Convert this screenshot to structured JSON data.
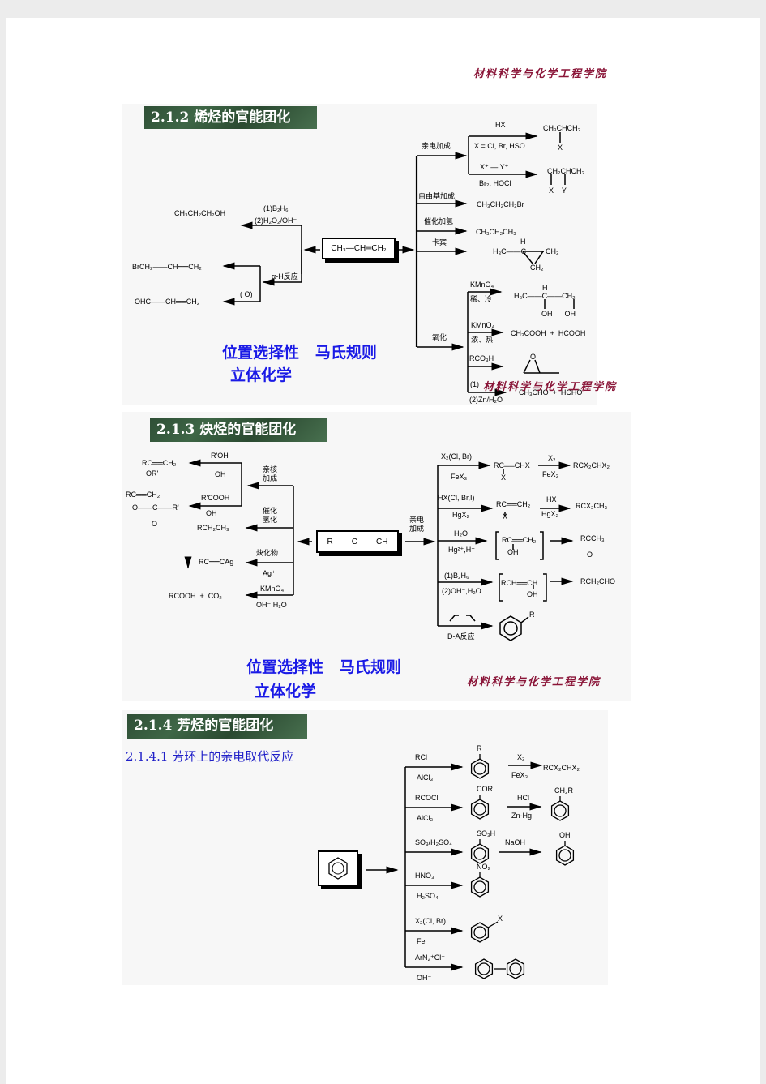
{
  "header": {
    "watermark": "材料科学与化学工程学院"
  },
  "section_212": {
    "title": "2.1.2 烯烃的官能团化",
    "center": "CH₃—CH═CH₂",
    "left": {
      "hydroboration": {
        "reagent_top": "(1)B₂H₆",
        "reagent_bottom": "(2)H₂O₂/OH⁻",
        "product": "CH₃CH₂CH₂OH"
      },
      "alpha_h_label": "α-H反应",
      "allyl_bromide": "BrCH₂——CH══CH₂",
      "oxidation_label": "( O)",
      "acrolein": "OHC——CH══CH₂"
    },
    "right": {
      "electrophilic": {
        "label": "亲电加成",
        "hx_reagent": "HX",
        "hx_note": "X = Cl, Br, HSO",
        "hx_product_top": "CH₃CHCH₃",
        "hx_product_sub": "X",
        "xy_reagent": "X⁺ — Y⁺",
        "xy_note": "Br₂, HOCl",
        "xy_product_top": "CH₂CHCH₃",
        "xy_product_sub": "X    Y"
      },
      "radical": {
        "label": "自由基加成",
        "product": "CH₃CH₂CH₂Br"
      },
      "hydrogenation": {
        "label": "催化加氢",
        "product": "CH₃CH₂CH₃"
      },
      "carbene": {
        "label": "卡宾",
        "product_h": "H",
        "product_left": "H₃C——C",
        "product_right": "CH₂",
        "product_bottom": "CH₂"
      },
      "oxidation": {
        "label": "氧化",
        "kmno4_cold": {
          "reagent": "KMnO₄",
          "cond": "稀、冷",
          "product_h": "H",
          "product": "H₃C——C——CH₂",
          "product_oh": "OH      OH"
        },
        "kmno4_hot": {
          "reagent": "KMnO₄",
          "cond": "浓、热",
          "product": "CH₃COOH  +  HCOOH"
        },
        "peracid": {
          "reagent": "RCO₃H",
          "product_o": "O"
        },
        "ozonolysis": {
          "reagent_top": "(1)",
          "reagent_bottom": "(2)Zn/H₂O",
          "product": "CH₃CHO  +  HCHO"
        }
      }
    },
    "notes": {
      "line1": "位置选择性   马氏规则",
      "line2": "立体化学"
    },
    "watermark": "材料科学与化学工程学院"
  },
  "section_213": {
    "title": "2.1.3 炔烃的官能团化",
    "center_r": "R",
    "center_c": "C",
    "center_ch": "CH",
    "left": {
      "nucleophilic_label": "亲核\n加成",
      "ether": {
        "reagent_top": "R'OH",
        "reagent_bottom": "OH⁻",
        "product_top": "RC══CH₂",
        "product_sub": "OR'"
      },
      "ester": {
        "reagent_top": "R'COOH",
        "reagent_bottom": "OH⁻",
        "product_top": "RC══CH₂",
        "product_mid": "O——C——R'",
        "product_bottom": "O"
      },
      "hydrogenation": {
        "label": "催化\n氢化",
        "product": "RCH₂CH₃"
      },
      "acetylide": {
        "label": "炔化物",
        "reagent": "Ag⁺",
        "product": "RC══CAg",
        "precipitate": "↓"
      },
      "oxidation": {
        "reagent_top": "KMnO₄",
        "reagent_bottom": "OH⁻,H₂O",
        "product": "RCOOH  +  CO₂"
      }
    },
    "right": {
      "label": "亲电\n加成",
      "halogen": {
        "reagent_top": "X₂(Cl, Br)",
        "reagent_bottom": "FeX₃",
        "intermediate": "RC══CHX",
        "intermediate_sub": "X",
        "step2_top": "X₂",
        "step2_bottom": "FeX₃",
        "product": "RCX₂CHX₂"
      },
      "hx": {
        "reagent_top": "HX(Cl, Br,I)",
        "reagent_bottom": "HgX₂",
        "intermediate": "RC══CH₂",
        "intermediate_sub": "X",
        "step2_top": "HX",
        "step2_bottom": "HgX₂",
        "product": "RCX₂CH₃"
      },
      "hydration": {
        "reagent_top": "H₂O",
        "reagent_bottom": "Hg²⁺,H⁺",
        "intermediate": "RC══CH₂",
        "intermediate_sub": "OH",
        "product": "RCCH₃",
        "product_sub": "O"
      },
      "hydroboration": {
        "reagent_top": "(1)B₂H₆",
        "reagent_bottom": "(2)OH⁻,H₂O",
        "intermediate": "RCH══CH",
        "intermediate_sub": "OH",
        "product": "RCH₂CHO"
      },
      "diels_alder": {
        "reagent_bottom": "D-A反应",
        "product_r": "R"
      }
    },
    "notes": {
      "line1": "位置选择性   马氏规则",
      "line2": "立体化学"
    },
    "watermark": "材料科学与化学工程学院"
  },
  "section_214": {
    "title": "2.1.4 芳烃的官能团化",
    "subtitle": "2.1.4.1 芳环上的亲电取代反应",
    "reactions": [
      {
        "reagent_top": "RCl",
        "reagent_bottom": "AlCl₃",
        "substituent": "R",
        "step2_top": "X₂",
        "step2_bottom": "FeX₃",
        "product": "RCX₂CHX₂"
      },
      {
        "reagent_top": "RCOCl",
        "reagent_bottom": "AlCl₃",
        "substituent": "COR",
        "step2_top": "HCl",
        "step2_bottom": "Zn-Hg",
        "product": "CH₂R"
      },
      {
        "reagent_top": "SO₃/H₂SO₄",
        "reagent_bottom": "",
        "substituent": "SO₃H",
        "step2_top": "NaOH",
        "step2_bottom": "",
        "product": "OH"
      },
      {
        "reagent_top": "HNO₃",
        "reagent_bottom": "H₂SO₄",
        "substituent": "NO₂"
      },
      {
        "reagent_top": "X₂(Cl, Br)",
        "reagent_bottom": "Fe",
        "substituent": "X"
      },
      {
        "reagent_top": "ArN₂⁺Cl⁻",
        "reagent_bottom": "OH⁻",
        "substituent": "biphenyl"
      }
    ]
  }
}
